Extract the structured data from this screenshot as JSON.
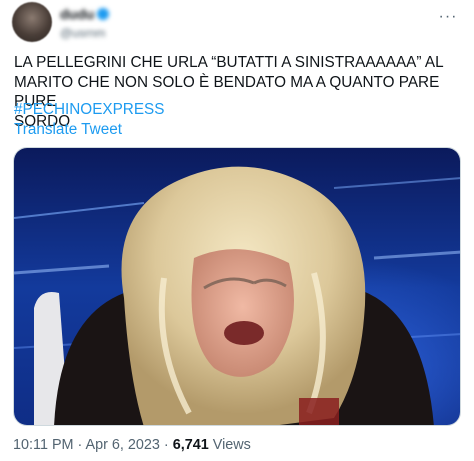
{
  "author": {
    "display_name": "dudu",
    "handle": "@usrnm",
    "verified": true,
    "avatar_icon": "avatar-photo"
  },
  "more_icon": "more-horizontal-icon",
  "tweet": {
    "text": "LA PELLEGRINI CHE URLA “BUTATTI A SINISTRAAAAAA” AL\nMARITO CHE NON SOLO È BENDATO MA A QUANTO PARE PURE\nSORDO",
    "hashtag": "#PECHINOEXPRESS",
    "translate_label": "Translate Tweet"
  },
  "media": {
    "kind": "photo"
  },
  "meta": {
    "time": "10:11 PM",
    "separator1": " · ",
    "date": "Apr 6, 2023",
    "separator2": " · ",
    "views_count": "6,741",
    "views_label": " Views"
  },
  "colors": {
    "link": "#1d9bf0",
    "text": "#0f1419",
    "secondary": "#536471"
  }
}
